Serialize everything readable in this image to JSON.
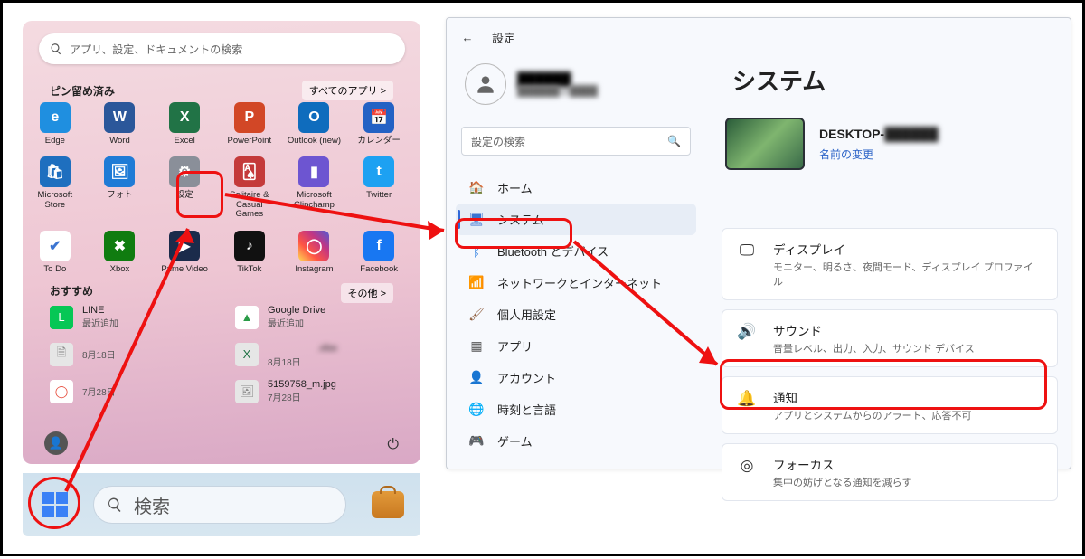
{
  "start": {
    "search_placeholder": "アプリ、設定、ドキュメントの検索",
    "pinned_label": "ピン留め済み",
    "all_apps_label": "すべてのアプリ  >",
    "apps": [
      {
        "label": "Edge",
        "bg": "#1f8fe0",
        "glyph": "e"
      },
      {
        "label": "Word",
        "bg": "#2b579a",
        "glyph": "W"
      },
      {
        "label": "Excel",
        "bg": "#217346",
        "glyph": "X"
      },
      {
        "label": "PowerPoint",
        "bg": "#d24726",
        "glyph": "P"
      },
      {
        "label": "Outlook (new)",
        "bg": "#0f6cbd",
        "glyph": "O"
      },
      {
        "label": "カレンダー",
        "bg": "#2361c4",
        "glyph": "📅"
      },
      {
        "label": "Microsoft Store",
        "bg": "#1e6fbf",
        "glyph": "🛍"
      },
      {
        "label": "フォト",
        "bg": "#1f7bd6",
        "glyph": "🖼"
      },
      {
        "label": "設定",
        "bg": "#8a8f99",
        "glyph": "⚙"
      },
      {
        "label": "Solitaire & Casual Games",
        "bg": "#c43a3a",
        "glyph": "🂡"
      },
      {
        "label": "Microsoft Clipchamp",
        "bg": "#6d55d1",
        "glyph": "▮"
      },
      {
        "label": "Twitter",
        "bg": "#1da1f2",
        "glyph": "t"
      },
      {
        "label": "To Do",
        "bg": "#ffffff",
        "glyph": "✔",
        "fg": "#3b74d1"
      },
      {
        "label": "Xbox",
        "bg": "#107c10",
        "glyph": "✖"
      },
      {
        "label": "Prime Video",
        "bg": "#1b2b4b",
        "glyph": "▶"
      },
      {
        "label": "TikTok",
        "bg": "#111",
        "glyph": "♪"
      },
      {
        "label": "Instagram",
        "bg": "linear-gradient(45deg,#fd5,#f54,#c13584,#4f5bd5)",
        "glyph": "◯"
      },
      {
        "label": "Facebook",
        "bg": "#1877f2",
        "glyph": "f"
      }
    ],
    "recommended_label": "おすすめ",
    "more_label": "その他  >",
    "recs": [
      {
        "t": "LINE",
        "s": "最近追加",
        "bg": "#06c755",
        "g": "L"
      },
      {
        "t": "Google Drive",
        "s": "最近追加",
        "bg": "#ffffff",
        "g": "▲",
        "fg": "#2a9b47"
      },
      {
        "t": "",
        "s": "8月18日",
        "bg": "#e6e6e6",
        "g": "🗎",
        "fg": "#888",
        "blur": true
      },
      {
        "t": "　　　　　.xlsx",
        "s": "8月18日",
        "bg": "#e6e6e6",
        "g": "X",
        "fg": "#217346",
        "blur": true
      },
      {
        "t": "",
        "s": "7月28日",
        "bg": "#ffffff",
        "g": "◯",
        "fg": "#e74c3c",
        "blur": true
      },
      {
        "t": "5159758_m.jpg",
        "s": "7月28日",
        "bg": "#e6e6e6",
        "g": "🖼",
        "fg": "#888"
      }
    ],
    "taskbar_search": "検索"
  },
  "settings": {
    "window_title": "設定",
    "user_name": "██████",
    "user_mail": "██████@████",
    "search_placeholder": "設定の検索",
    "title": "システム",
    "nav": [
      {
        "label": "ホーム",
        "glyph": "🏠",
        "color": "#3b74d1"
      },
      {
        "label": "システム",
        "glyph": "🖥",
        "color": "#3b74d1",
        "active": true
      },
      {
        "label": "Bluetooth とデバイス",
        "glyph": "ᛒ",
        "color": "#2b7de0"
      },
      {
        "label": "ネットワークとインターネット",
        "glyph": "📶",
        "color": "#2b9bd8"
      },
      {
        "label": "個人用設定",
        "glyph": "🖌",
        "color": "#8c5a3a"
      },
      {
        "label": "アプリ",
        "glyph": "▦",
        "color": "#555"
      },
      {
        "label": "アカウント",
        "glyph": "👤",
        "color": "#2a8a4a"
      },
      {
        "label": "時刻と言語",
        "glyph": "🌐",
        "color": "#3a6fb5"
      },
      {
        "label": "ゲーム",
        "glyph": "🎮",
        "color": "#888"
      }
    ],
    "pc_name": "DESKTOP-",
    "pc_name_blur": "██████",
    "rename_label": "名前の変更",
    "cards": [
      {
        "t": "ディスプレイ",
        "s": "モニター、明るさ、夜間モード、ディスプレイ プロファイル",
        "g": "🖵"
      },
      {
        "t": "サウンド",
        "s": "音量レベル、出力、入力、サウンド デバイス",
        "g": "🔊"
      },
      {
        "t": "通知",
        "s": "アプリとシステムからのアラート、応答不可",
        "g": "🔔"
      },
      {
        "t": "フォーカス",
        "s": "集中の妨げとなる通知を減らす",
        "g": "◎"
      }
    ]
  }
}
